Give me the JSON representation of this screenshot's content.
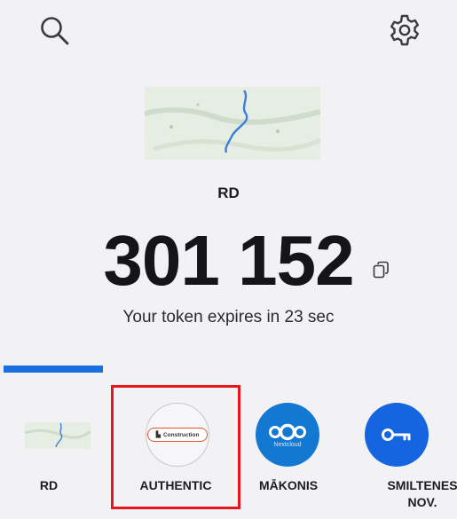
{
  "account": {
    "name": "RD",
    "code": "301 152",
    "expires_text": "Your token expires in 23 sec",
    "progress": 0.22
  },
  "tiles": [
    {
      "label": "RD",
      "icon": "map-thumbnail"
    },
    {
      "label": "AUTHENTIC",
      "icon": "construction-logo",
      "logo_text": "Construction"
    },
    {
      "label": "MĀKONIS",
      "icon": "nextcloud-logo",
      "logo_text": "Nextcloud"
    },
    {
      "label": "SMILTENES NOV.",
      "icon": "key-icon"
    }
  ],
  "colors": {
    "accent": "#1b6fe0",
    "highlight": "#e8161a",
    "background": "#f2f2f4"
  }
}
